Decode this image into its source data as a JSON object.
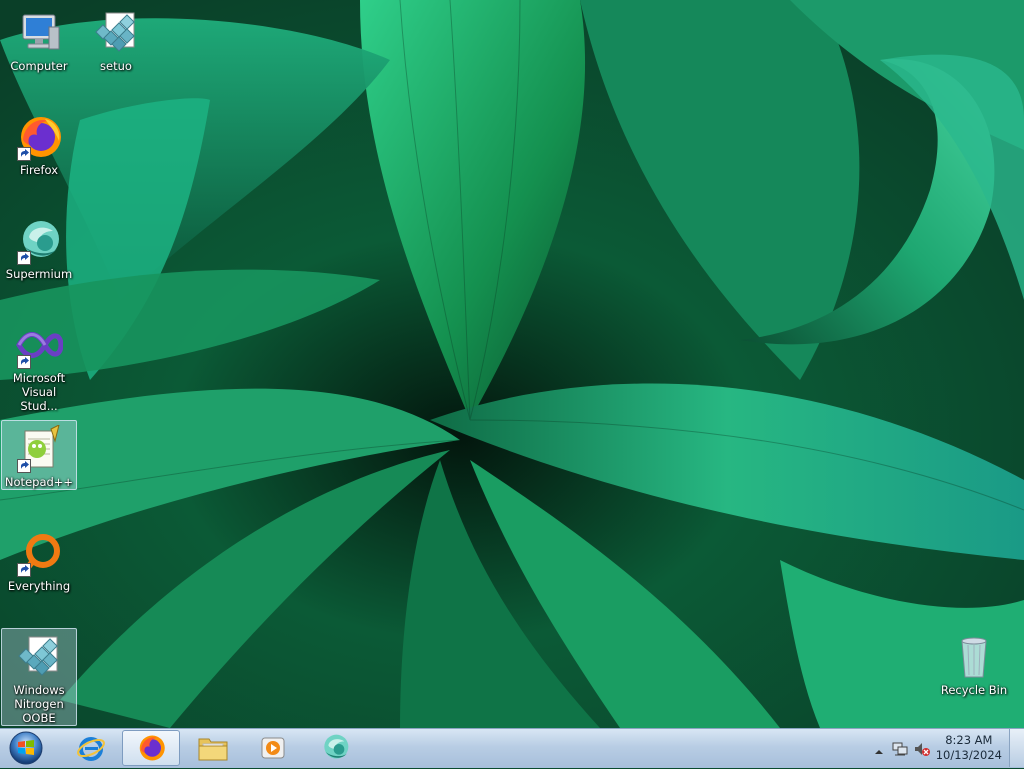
{
  "desktop": {
    "icons": [
      {
        "label": "Computer",
        "icon": "computer-icon",
        "selected": false
      },
      {
        "label": "setuo",
        "icon": "installer-icon",
        "selected": false
      },
      {
        "label": "Firefox",
        "icon": "firefox-icon",
        "selected": false
      },
      {
        "label": "Supermium",
        "icon": "supermium-icon",
        "selected": false
      },
      {
        "label": "Microsoft Visual Stud...",
        "icon": "visual-studio-icon",
        "selected": false
      },
      {
        "label": "Notepad++",
        "icon": "notepadpp-icon",
        "selected": true
      },
      {
        "label": "Everything",
        "icon": "everything-icon",
        "selected": false
      },
      {
        "label": "Windows Nitrogen OOBE",
        "icon": "installer-icon",
        "selected": true
      },
      {
        "label": "Recycle Bin",
        "icon": "recycle-bin-icon",
        "selected": false
      }
    ]
  },
  "taskbar": {
    "start": {
      "icon": "windows-start-orb-icon"
    },
    "pinned": [
      {
        "name": "Internet Explorer",
        "icon": "internet-explorer-icon",
        "active": false
      },
      {
        "name": "Firefox",
        "icon": "firefox-icon",
        "active": true
      },
      {
        "name": "Windows Explorer",
        "icon": "folder-icon",
        "active": false
      },
      {
        "name": "Windows Media Player",
        "icon": "media-player-icon",
        "active": false
      },
      {
        "name": "Supermium",
        "icon": "supermium-icon",
        "active": false
      }
    ],
    "tray": {
      "icons": [
        "show-hidden-icons-chevron",
        "network-icon",
        "volume-muted-icon"
      ],
      "time": "8:23 AM",
      "date": "10/13/2024"
    }
  },
  "colors": {
    "wallpaper_dark": "#0a3f28",
    "wallpaper_light": "#2fcf8a",
    "wallpaper_teal": "#1a9a86",
    "taskbar": "#b8cde4"
  }
}
